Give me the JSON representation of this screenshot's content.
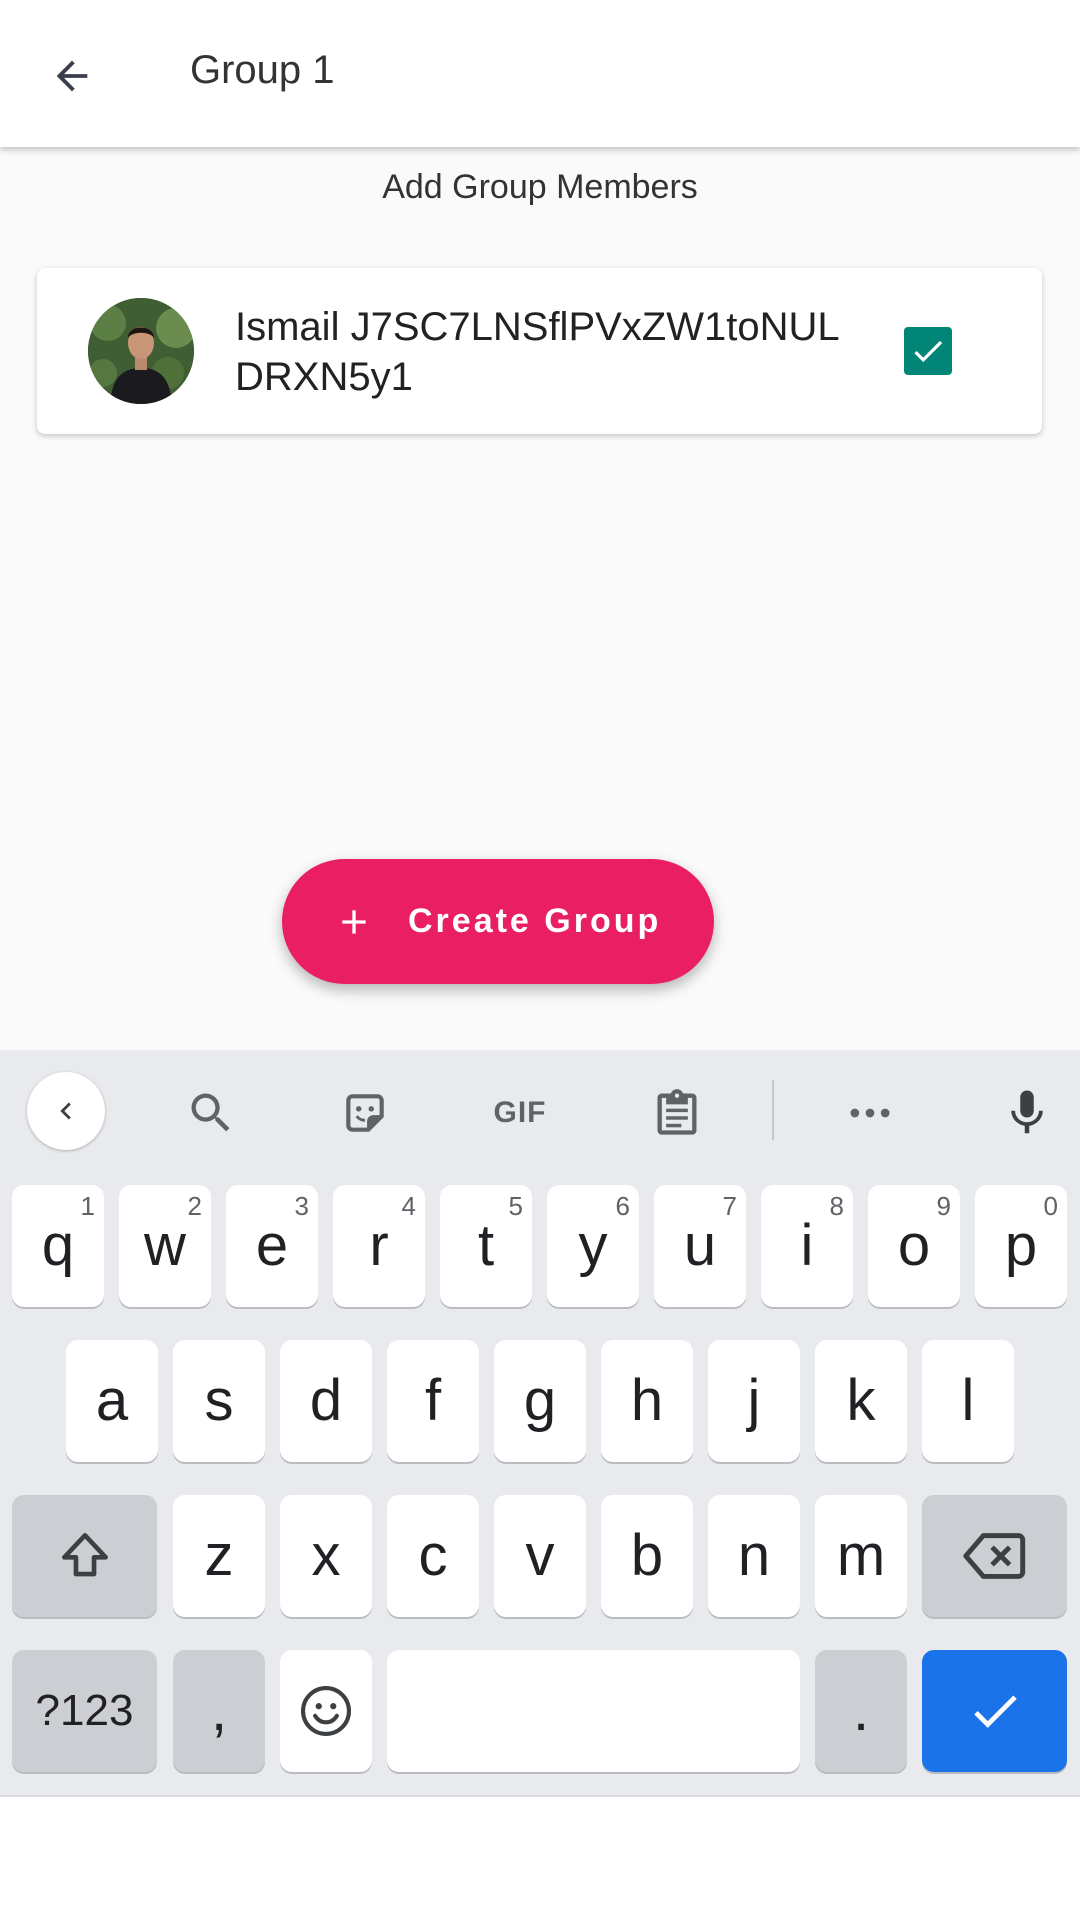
{
  "appbar": {
    "title": "Group 1",
    "back_icon": "arrow-back-icon"
  },
  "section": {
    "title": "Add Group Members"
  },
  "members": [
    {
      "name": "Ismail J7SC7LNSflPVxZW1toNULDRXN5y1",
      "checked": true
    }
  ],
  "fab": {
    "label": "Create Group",
    "icon": "plus-icon"
  },
  "colors": {
    "accent": "#e91e63",
    "checkbox": "#008577",
    "keyboard_enter": "#1a73e8",
    "keyboard_bg": "#e8eaed"
  },
  "keyboard": {
    "toolbar": {
      "gif_label": "GIF"
    },
    "row1": [
      {
        "key": "q",
        "hint": "1"
      },
      {
        "key": "w",
        "hint": "2"
      },
      {
        "key": "e",
        "hint": "3"
      },
      {
        "key": "r",
        "hint": "4"
      },
      {
        "key": "t",
        "hint": "5"
      },
      {
        "key": "y",
        "hint": "6"
      },
      {
        "key": "u",
        "hint": "7"
      },
      {
        "key": "i",
        "hint": "8"
      },
      {
        "key": "o",
        "hint": "9"
      },
      {
        "key": "p",
        "hint": "0"
      }
    ],
    "row2": [
      "a",
      "s",
      "d",
      "f",
      "g",
      "h",
      "j",
      "k",
      "l"
    ],
    "row3": [
      "z",
      "x",
      "c",
      "v",
      "b",
      "n",
      "m"
    ],
    "symbols_label": "?123",
    "comma_label": ",",
    "period_label": "."
  }
}
